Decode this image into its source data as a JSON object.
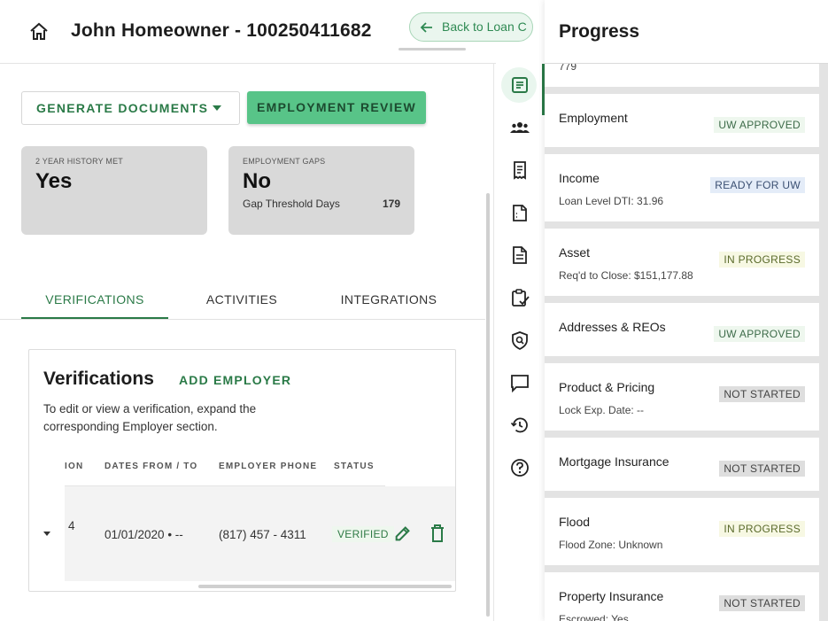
{
  "header": {
    "title": "John Homeowner - 100250411682",
    "back_button": "Back to Loan C"
  },
  "actions": {
    "generate_documents": "GENERATE DOCUMENTS",
    "employment_review": "EMPLOYMENT REVIEW"
  },
  "summary": {
    "history": {
      "label": "2 YEAR HISTORY MET",
      "value": "Yes"
    },
    "gaps": {
      "label": "EMPLOYMENT GAPS",
      "value": "No",
      "threshold_label": "Gap Threshold Days",
      "threshold_value": "179"
    }
  },
  "tabs": [
    "VERIFICATIONS",
    "ACTIVITIES",
    "INTEGRATIONS"
  ],
  "verifications": {
    "title": "Verifications",
    "add_employer": "ADD EMPLOYER",
    "description": "To edit or view a verification, expand the corresponding Employer section.",
    "columns": [
      "ION",
      "DATES FROM / TO",
      "EMPLOYER PHONE",
      "STATUS"
    ],
    "row": {
      "partial": "4",
      "dates": "01/01/2020 • --",
      "phone": "(817) 457 - 4311",
      "status": "VERIFIED"
    }
  },
  "progress": {
    "title": "Progress",
    "top_partial": "779",
    "items": [
      {
        "name": "Employment",
        "sub": "",
        "status": "UW APPROVED"
      },
      {
        "name": "Income",
        "sub": "Loan Level DTI: 31.96",
        "status": "READY FOR UW"
      },
      {
        "name": "Asset",
        "sub": "Req'd to Close: $151,177.88",
        "status": "IN PROGRESS"
      },
      {
        "name": "Addresses & REOs",
        "sub": "",
        "status": "UW APPROVED"
      },
      {
        "name": "Product & Pricing",
        "sub": "Lock Exp. Date: --",
        "status": "NOT STARTED"
      },
      {
        "name": "Mortgage Insurance",
        "sub": "",
        "status": "NOT STARTED"
      },
      {
        "name": "Flood",
        "sub": "Flood Zone: Unknown",
        "status": "IN PROGRESS"
      },
      {
        "name": "Property Insurance",
        "sub": "Escrowed: Yes",
        "status": "NOT STARTED"
      }
    ]
  },
  "rail_icons": [
    "progress-icon",
    "people-icon",
    "receipt-icon",
    "document-icon",
    "file-icon",
    "checklist-icon",
    "shield-search-icon",
    "chat-icon",
    "history-icon",
    "help-icon"
  ],
  "colors": {
    "accent": "#2a7a47",
    "primary_button": "#58c488",
    "card_bg": "#d9d9d9"
  }
}
